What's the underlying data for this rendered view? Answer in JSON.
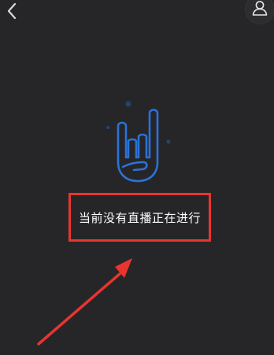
{
  "header": {
    "back_icon": "chevron-left-icon",
    "profile_icon": "user-icon"
  },
  "empty_state": {
    "illustration_icon": "rock-hand-icon",
    "message": "当前没有直播正在进行"
  },
  "annotation": {
    "highlight_color": "#e8352f",
    "arrow_color": "#e8352f"
  },
  "colors": {
    "background": "#262628",
    "accent_blue": "#2b72d9",
    "dot_blue": "#23436d"
  }
}
